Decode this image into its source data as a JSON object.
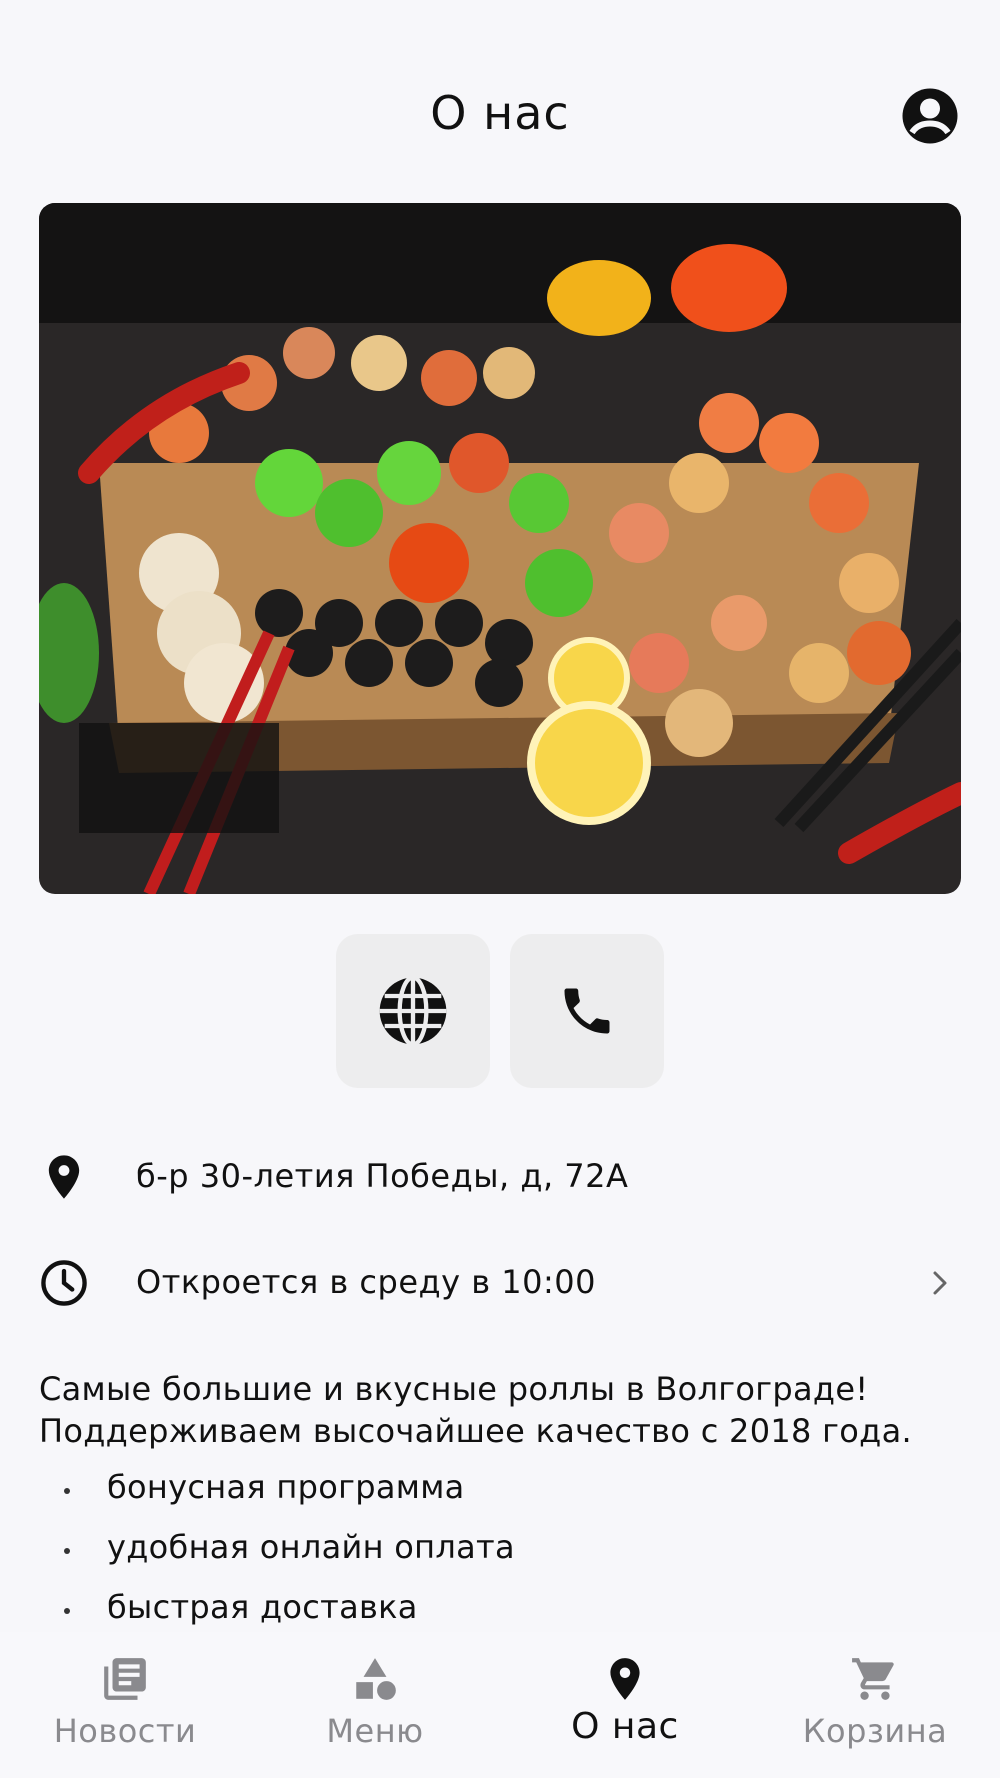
{
  "header": {
    "title": "О нас",
    "profile_icon": "account-circle-icon"
  },
  "hero": {
    "image": "sushi-platter-photo"
  },
  "actions": [
    {
      "icon": "globe-icon"
    },
    {
      "icon": "phone-icon"
    }
  ],
  "info": {
    "address": "б-р 30-летия Победы, д, 72А",
    "hours": "Откроется в среду в 10:00"
  },
  "description": {
    "line1": "Самые большие и вкусные роллы в Волгограде!",
    "line2": "Поддерживаем высочайшее качество с 2018 года.",
    "bullets": [
      "бонусная программа",
      "удобная онлайн оплата",
      "быстрая доставка"
    ]
  },
  "nav": {
    "items": [
      {
        "label": "Новости",
        "icon": "news-icon",
        "active": false
      },
      {
        "label": "Меню",
        "icon": "shapes-icon",
        "active": false
      },
      {
        "label": "О нас",
        "icon": "location-pin-icon",
        "active": true
      },
      {
        "label": "Корзина",
        "icon": "cart-icon",
        "active": false
      }
    ]
  },
  "colors": {
    "background": "#f7f7fa",
    "text": "#111111",
    "inactive": "#8a8a8e",
    "button_bg": "#ededee"
  }
}
